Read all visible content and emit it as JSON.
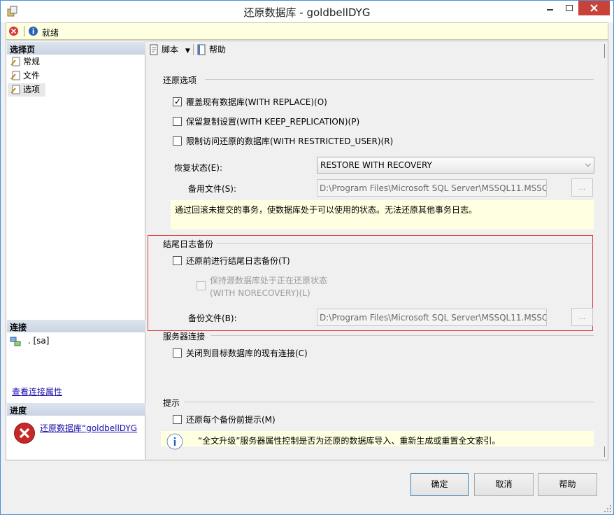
{
  "window": {
    "title": "还原数据库 - goldbellDYG"
  },
  "status": {
    "text": "就绪"
  },
  "left": {
    "select_page_header": "选择页",
    "nav": [
      {
        "label": "常规"
      },
      {
        "label": "文件"
      },
      {
        "label": "选项"
      }
    ],
    "connection_header": "连接",
    "connection_value": ". [sa]",
    "view_connection_link": "查看连接属性",
    "progress_header": "进度",
    "progress_link": "还原数据库“goldbellDYG"
  },
  "toolbar": {
    "script_label": "脚本",
    "help_label": "帮助"
  },
  "restore_options": {
    "title": "还原选项",
    "overwrite": "覆盖现有数据库(WITH REPLACE)(O)",
    "keep_replication": "保留复制设置(WITH KEEP_REPLICATION)(P)",
    "restricted_user": "限制访问还原的数据库(WITH RESTRICTED_USER)(R)",
    "recovery_state_label": "恢复状态(E):",
    "recovery_state_value": "RESTORE WITH RECOVERY",
    "standby_file_label": "备用文件(S):",
    "standby_file_value": "D:\\Program Files\\Microsoft SQL Server\\MSSQL11.MSSQ",
    "browse": "...",
    "info": "通过回滚未提交的事务，使数据库处于可以使用的状态。无法还原其他事务日志。"
  },
  "tail_log": {
    "title": "结尾日志备份",
    "take_tail_log": "还原前进行结尾日志备份(T)",
    "norecovery_line1": "保持源数据库处于正在还原状态",
    "norecovery_line2": "(WITH NORECOVERY)(L)",
    "backup_file_label": "备份文件(B):",
    "backup_file_value": "D:\\Program Files\\Microsoft SQL Server\\MSSQL11.MSSQ",
    "browse": "..."
  },
  "server_connections": {
    "title": "服务器连接",
    "close_connections": "关闭到目标数据库的现有连接(C)"
  },
  "prompt": {
    "title": "提示",
    "prompt_before_each": "还原每个备份前提示(M)",
    "info": "“全文升级”服务器属性控制是否为还原的数据库导入、重新生成或重置全文索引。"
  },
  "buttons": {
    "ok": "确定",
    "cancel": "取消",
    "help": "帮助"
  },
  "colors": {
    "title_close": "#c7433a",
    "status_bg": "#ffffe1",
    "highlight_box": "#e04040"
  }
}
